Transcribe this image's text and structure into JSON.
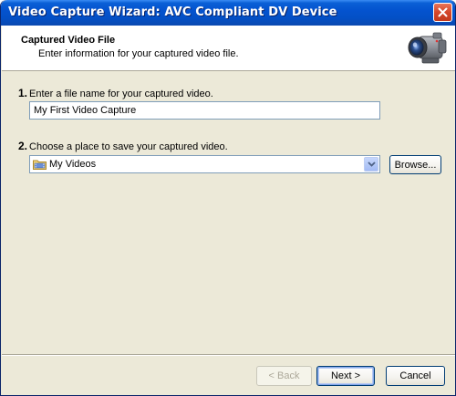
{
  "window": {
    "title": "Video Capture Wizard: AVC Compliant DV Device"
  },
  "header": {
    "title": "Captured Video File",
    "subtitle": "Enter information for your captured video file.",
    "icon": "camcorder-icon"
  },
  "step1": {
    "number": "1.",
    "label": "Enter a file name for your captured video.",
    "value": "My First Video Capture"
  },
  "step2": {
    "number": "2.",
    "label": "Choose a place to save your captured video.",
    "selected": "My Videos",
    "browse_label": "Browse..."
  },
  "footer": {
    "back_label": "< Back",
    "next_label": "Next >",
    "cancel_label": "Cancel"
  }
}
